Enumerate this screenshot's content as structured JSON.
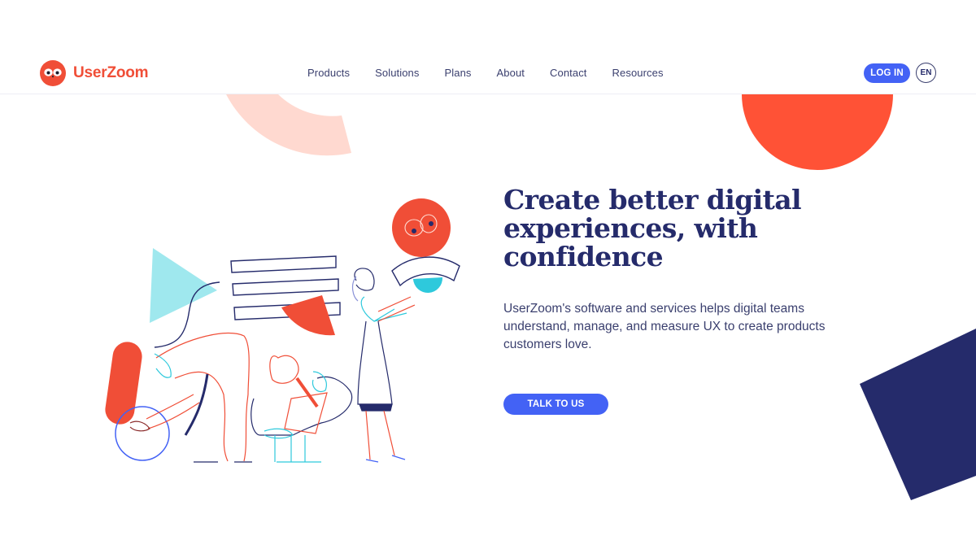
{
  "brand": {
    "name": "UserZoom",
    "logo_icon": "owl-icon",
    "colors": {
      "primary_red": "#f04e37",
      "navy": "#252b6b",
      "button_blue": "#4362f5",
      "peach": "#ffd9d0",
      "cyan": "#9fe8ee",
      "teal": "#2ec9dc"
    }
  },
  "nav": {
    "items": [
      {
        "label": "Products"
      },
      {
        "label": "Solutions"
      },
      {
        "label": "Plans"
      },
      {
        "label": "About"
      },
      {
        "label": "Contact"
      },
      {
        "label": "Resources"
      }
    ],
    "login_label": "LOG IN",
    "language_label": "EN"
  },
  "hero": {
    "title": "Create better digital experiences, with confidence",
    "body": "UserZoom's software and services helps digital teams understand, manage, and measure UX to create products customers love.",
    "cta_label": "TALK TO US",
    "illustration": "team-collaboration-illustration"
  }
}
